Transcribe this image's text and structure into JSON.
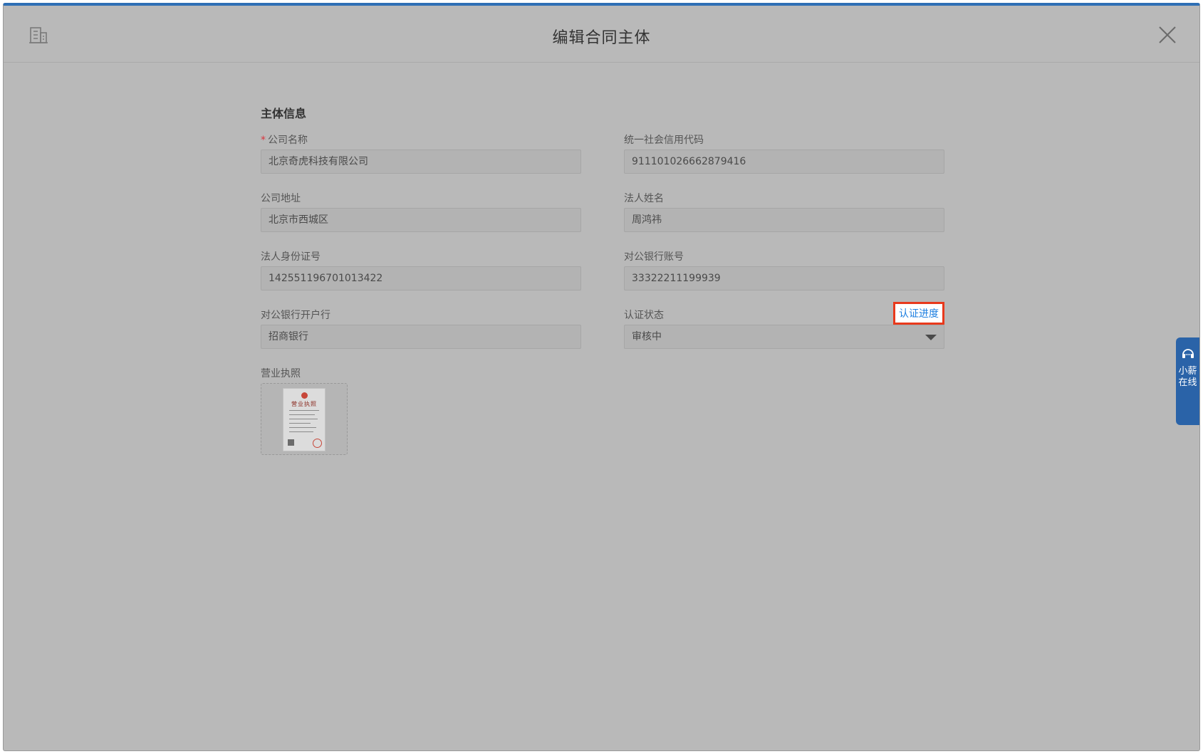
{
  "dialog": {
    "title": "编辑合同主体",
    "icon": "building-icon",
    "close_icon": "close-icon"
  },
  "section": {
    "title": "主体信息"
  },
  "fields": {
    "company_name": {
      "required_mark": "*",
      "label": "公司名称",
      "value": "北京奇虎科技有限公司"
    },
    "credit_code": {
      "label": "统一社会信用代码",
      "value": "911101026662879416"
    },
    "company_address": {
      "label": "公司地址",
      "value": "北京市西城区"
    },
    "legal_name": {
      "label": "法人姓名",
      "value": "周鸿祎"
    },
    "legal_id": {
      "label": "法人身份证号",
      "value": "142551196701013422"
    },
    "bank_account": {
      "label": "对公银行账号",
      "value": "33322211199939"
    },
    "bank_name": {
      "label": "对公银行开户行",
      "value": "招商银行"
    },
    "cert_status": {
      "label": "认证状态",
      "value": "审核中",
      "link": "认证进度"
    },
    "license": {
      "label": "营业执照",
      "image_icon": "business-license-thumbnail",
      "image_text": "营业执照"
    }
  },
  "service_widget": {
    "icon": "headset-icon",
    "label": "小薪在线"
  },
  "colors": {
    "accent": "#2e6fb5",
    "link": "#1e7fe0",
    "highlight_border": "#e8391c",
    "required": "#d9363e",
    "overlay_bg": "#b9b9b9"
  }
}
